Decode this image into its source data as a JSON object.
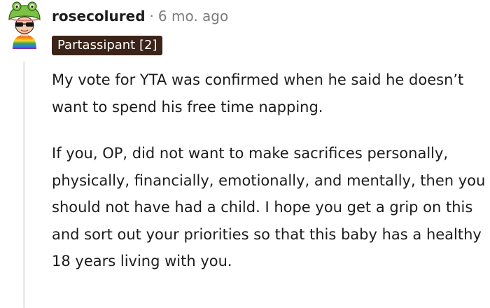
{
  "comment": {
    "author": "rosecolured",
    "separator": "·",
    "time_ago": "6 mo. ago",
    "flair": "Partassipant [2]",
    "paragraphs": [
      "My vote for YTA was confirmed when he said he doesn’t want to spend his free time napping.",
      "If you, OP, did not want to make sacrifices personally, physically, financially, emotionally, and mentally, then you should not have had a child. I hope you get a grip on this and sort out your priorities so that this baby has a healthy 18 years living with you."
    ]
  },
  "colors": {
    "flair_background": "#3b2417",
    "flair_text": "#ffffff",
    "username": "#1c1c1c",
    "meta_gray": "#7c7c7c",
    "thread_line": "#e9ebee",
    "avatar_frog": "#7cc242",
    "avatar_shirt_rainbow": [
      "#e53935",
      "#fb8c00",
      "#fdd835",
      "#43a047",
      "#1e88e5",
      "#8e24aa"
    ]
  },
  "icons": {
    "avatar": "frog-hat-sunglasses-avatar"
  }
}
